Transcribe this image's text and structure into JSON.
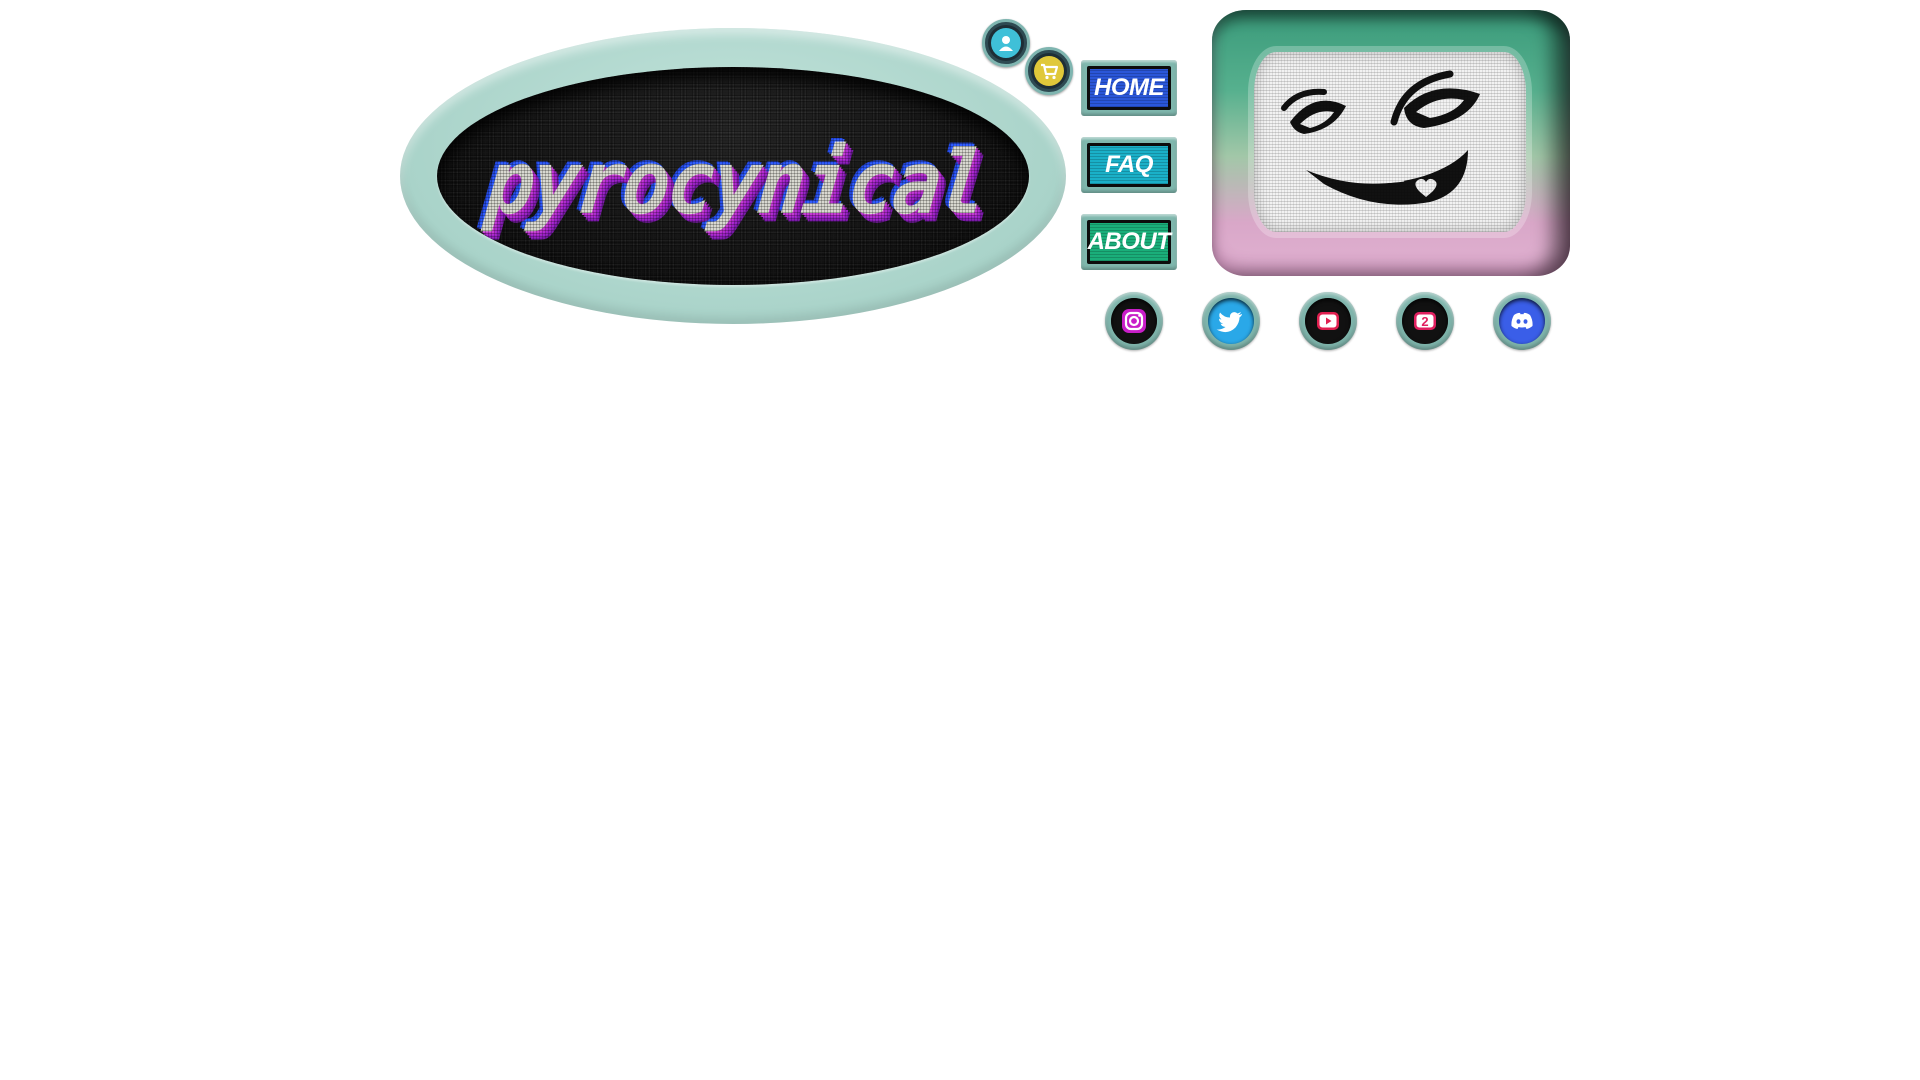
{
  "logo": {
    "text": "pyrocynical"
  },
  "header_icons": [
    {
      "name": "account",
      "icon": "user-icon",
      "color": "#3fc0d8"
    },
    {
      "name": "cart",
      "icon": "cart-icon",
      "color": "#e0c83a"
    }
  ],
  "nav": {
    "items": [
      {
        "label": "HOME",
        "color": "#2a56d8"
      },
      {
        "label": "FAQ",
        "color": "#1ab0c8"
      },
      {
        "label": "ABOUT",
        "color": "#1aae7a"
      }
    ]
  },
  "tv": {
    "face": "grinning-face-icon"
  },
  "social": [
    {
      "name": "instagram",
      "icon": "instagram-icon",
      "color": "#c81ec8"
    },
    {
      "name": "twitter",
      "icon": "twitter-icon",
      "color": "#2aa8e8"
    },
    {
      "name": "youtube",
      "icon": "youtube-icon",
      "color": "#e02050"
    },
    {
      "name": "2",
      "label": "2",
      "icon": "number-2-icon",
      "color": "#e02060"
    },
    {
      "name": "discord",
      "icon": "discord-icon",
      "color": "#3a5ee8"
    }
  ]
}
